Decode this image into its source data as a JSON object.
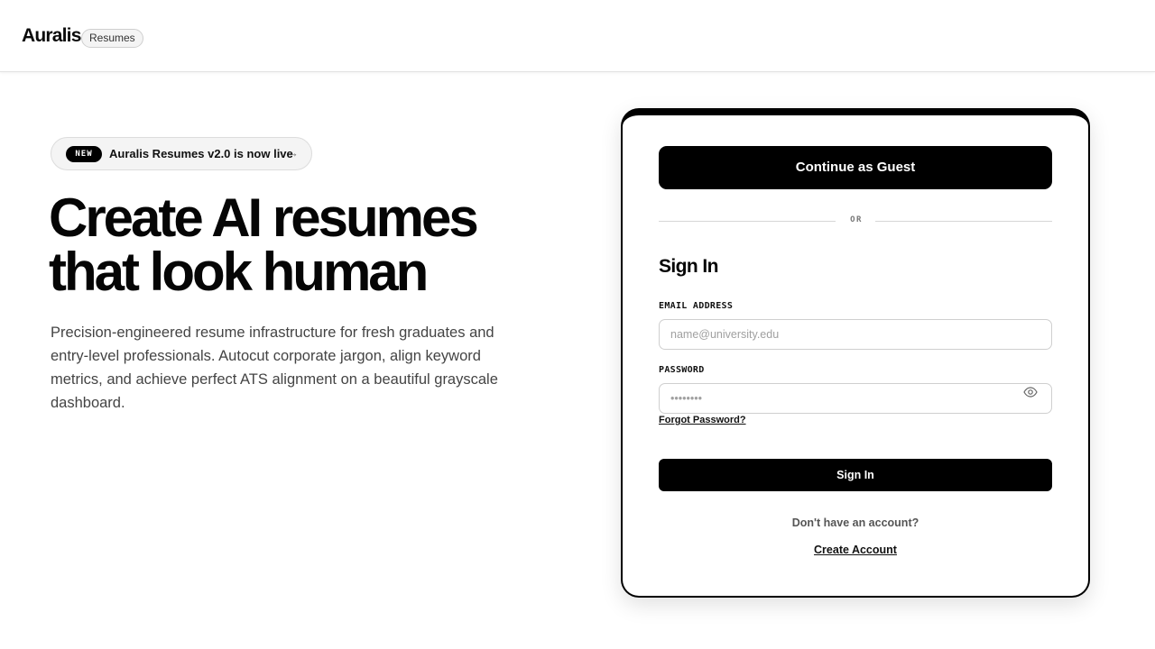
{
  "header": {
    "brand": "Auralis",
    "product_pill": "Resumes"
  },
  "announcement": {
    "badge": "NEW",
    "text": "Auralis Resumes v2.0 is now live",
    "arrow": "→"
  },
  "hero": {
    "title_line1": "Create AI resumes",
    "title_line2": "that look human",
    "description": "Precision-engineered resume infrastructure for fresh graduates and entry-level professionals. Autocut corporate jargon, align keyword metrics, and achieve perfect ATS alignment on a beautiful grayscale dashboard."
  },
  "auth_card": {
    "guest_button": "Continue as Guest",
    "divider_text": "OR",
    "signin_title": "Sign In",
    "email_label": "EMAIL ADDRESS",
    "email_placeholder": "name@university.edu",
    "email_value": "",
    "password_label": "PASSWORD",
    "password_placeholder": "••••••••",
    "password_value": "",
    "password_toggle_icon": "eye-icon",
    "forgot_link": "Forgot Password?",
    "signin_button": "Sign In",
    "no_account_text": "Don't have an account?",
    "create_account_link": "Create Account"
  },
  "colors": {
    "primary": "#000000",
    "text": "#0a0a0a",
    "muted": "#444444",
    "border": "#cfcfcf",
    "background": "#ffffff"
  }
}
